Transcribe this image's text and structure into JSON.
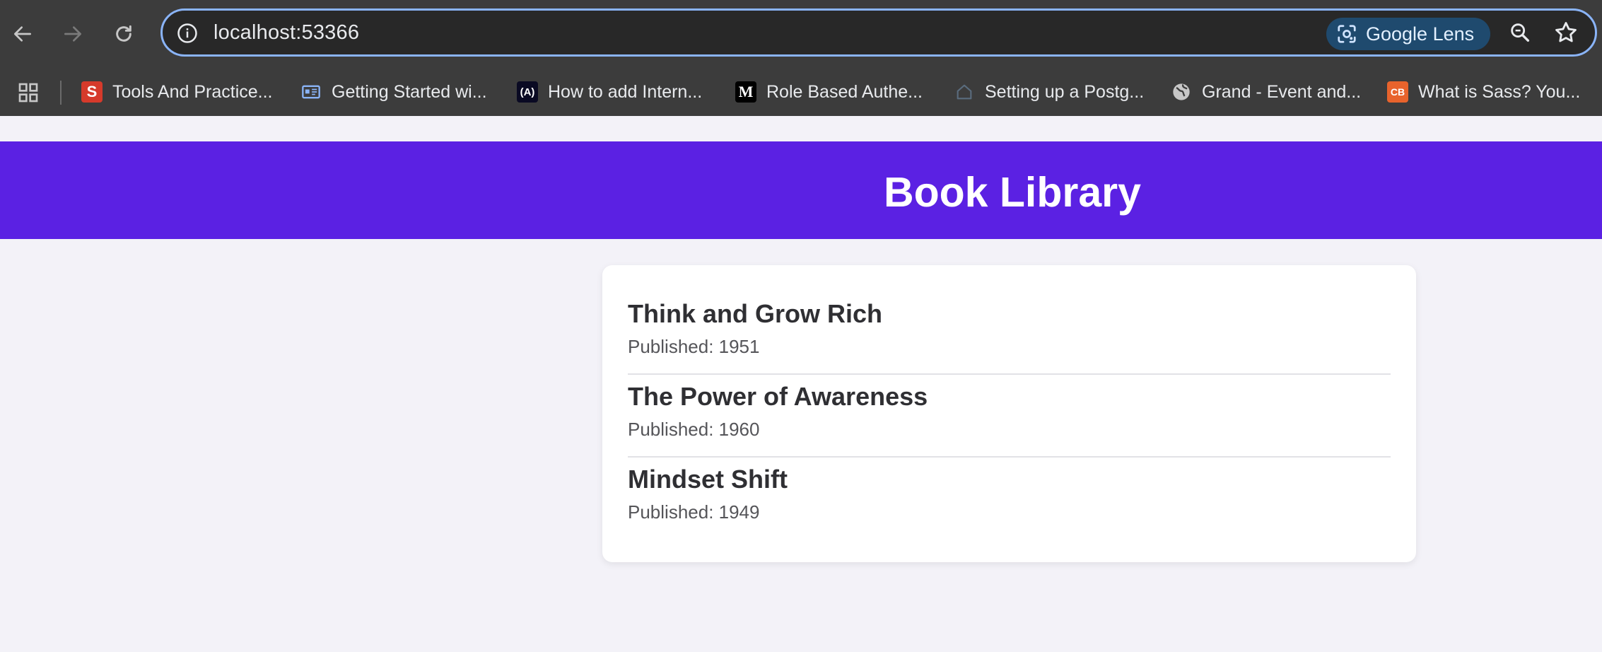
{
  "browser": {
    "url": "localhost:53366",
    "lens_label": "Google Lens",
    "bookmarks": [
      {
        "label": "Tools And Practice...",
        "favicon": "S",
        "color": "#d63a2b"
      },
      {
        "label": "Getting Started wi...",
        "favicon": "card",
        "color": "#8ab4f8"
      },
      {
        "label": "How to add Intern...",
        "favicon": "(A)",
        "color": "#0a0a23"
      },
      {
        "label": "Role Based Authe...",
        "favicon": "M",
        "color": "#000000"
      },
      {
        "label": "Setting up a Postg...",
        "favicon": "house",
        "color": "#3c3c3c"
      },
      {
        "label": "Grand - Event and...",
        "favicon": "globe",
        "color": "#3c3c3c"
      },
      {
        "label": "What is Sass? You...",
        "favicon": "CB",
        "color": "#e8632c"
      }
    ]
  },
  "page": {
    "title": "Book Library",
    "accent": "#5b21e3",
    "books": [
      {
        "title": "Think and Grow Rich",
        "published": "Published: 1951"
      },
      {
        "title": "The Power of Awareness",
        "published": "Published: 1960"
      },
      {
        "title": "Mindset Shift",
        "published": "Published: 1949"
      }
    ]
  }
}
